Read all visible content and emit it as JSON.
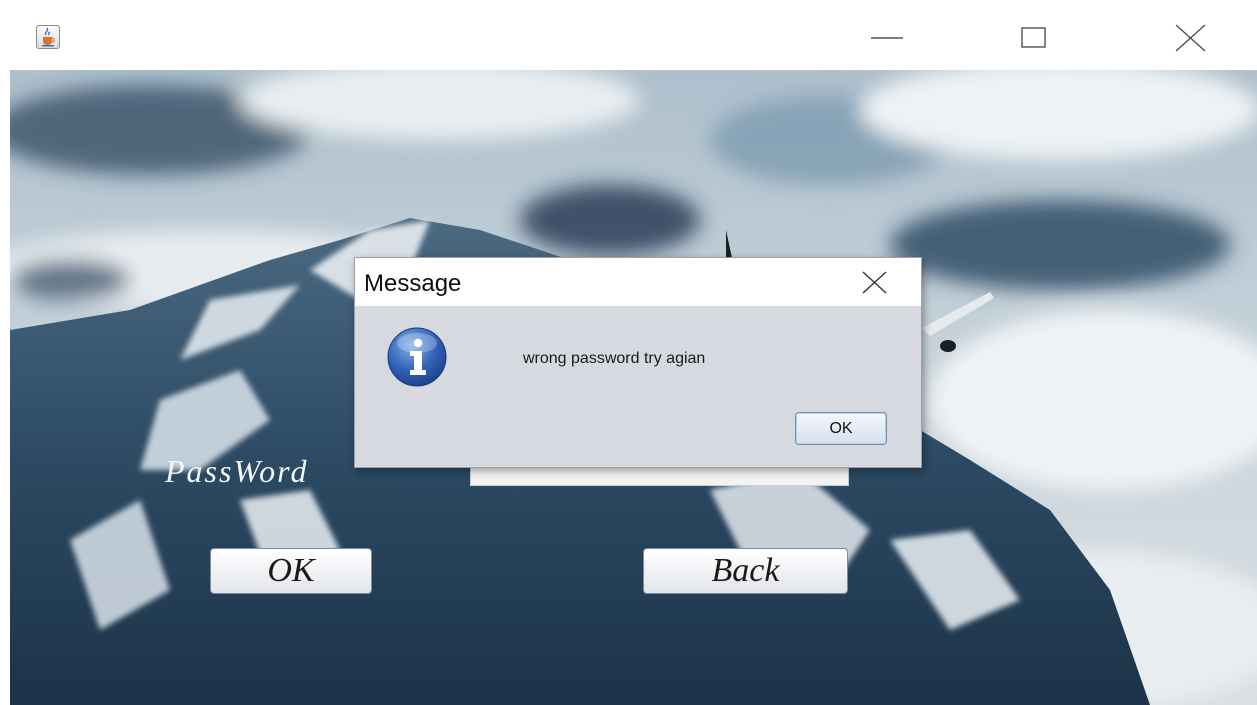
{
  "window": {
    "icon": "java-cup-icon",
    "controls": {
      "minimize": "minimize-icon",
      "maximize": "maximize-icon",
      "close": "close-icon"
    }
  },
  "form": {
    "password_label": "PassWord",
    "password_value": "",
    "ok_label": "OK",
    "back_label": "Back"
  },
  "dialog": {
    "title": "Message",
    "message": "wrong password try agian",
    "ok_label": "OK",
    "icon": "info-icon"
  },
  "colors": {
    "dialog_body": "#d6d9df",
    "info_blue": "#2f5fb4",
    "sky": "#9fb4c4"
  }
}
